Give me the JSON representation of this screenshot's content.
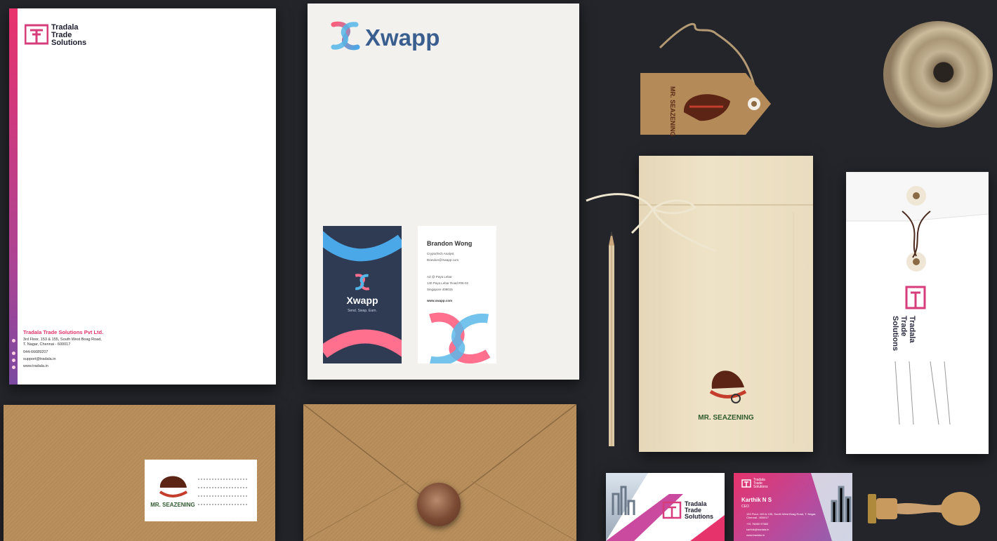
{
  "letterhead": {
    "brand_lines": [
      "Tradala",
      "Trade",
      "Solutions"
    ],
    "company": "Tradala Trade Solutions Pvt Ltd.",
    "address_lines": [
      "3rd Floor, 153 & 155, South West Boag Road,",
      "T. Nagar, Chennai - 600017"
    ],
    "phone": "044-66689207",
    "email": "support@tradala.in",
    "web": "www.tradala.in"
  },
  "folder": {
    "brand": "Xwapp",
    "dark_card": {
      "brand": "Xwapp",
      "tagline": "Send. Swap. Earn."
    },
    "light_card": {
      "name": "Brandon Wong",
      "title": "CryptoTech Analyst",
      "email": "Brandon@Xwapp.com",
      "address_lines": [
        "AZ @ Paya Lebar",
        "140 Paya Lebar Road #06-02",
        "Singapore 409015"
      ],
      "web": "www.xwapp.com"
    }
  },
  "pouch": {
    "brand": "MR. SEAZENING"
  },
  "tag": {
    "brand": "MR. SEAZENING"
  },
  "kraft_label": {
    "brand": "MR. SEAZENING"
  },
  "envelope_right": {
    "brand_lines": [
      "Tradala",
      "Trade",
      "Solutions"
    ]
  },
  "card_front": {
    "brand_lines": [
      "Tradala",
      "Trade",
      "Solutions"
    ]
  },
  "card_back": {
    "brand_lines": [
      "Tradala",
      "Trade",
      "Solutions"
    ],
    "name": "Karthik N S",
    "role": "CEO",
    "lines": [
      "153 Floor, 153 & 155, South West Boag Road, T. Nagar, Chennai - 600017",
      "+91 76660 97660",
      "karthik@tradala.in",
      "www.tradala.in"
    ]
  },
  "colors": {
    "background": "#23252a",
    "tradala_pink": "#e0336a",
    "xwapp_blue": "#3a5f8f",
    "seazening_green": "#2f5b2e"
  }
}
